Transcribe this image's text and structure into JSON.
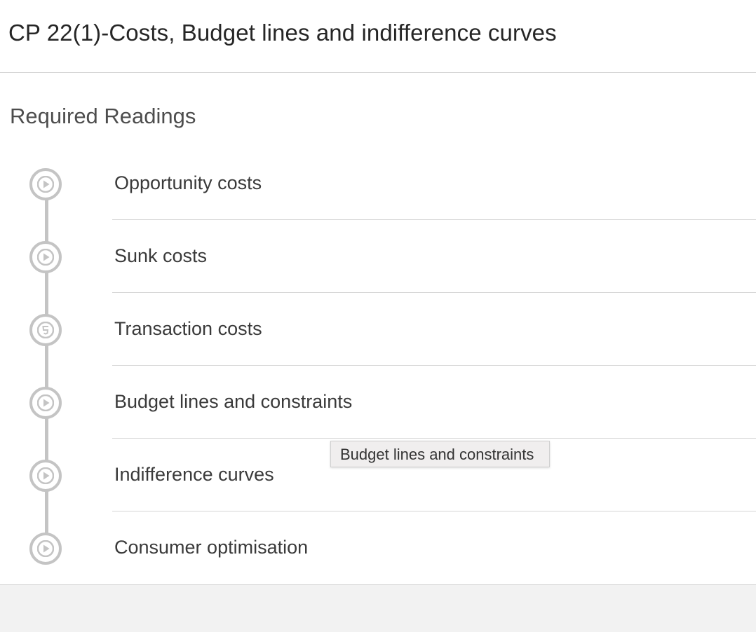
{
  "header": {
    "title": "CP 22(1)-Costs, Budget lines and indifference curves"
  },
  "section": {
    "heading": "Required Readings"
  },
  "readings": [
    {
      "label": "Opportunity costs",
      "icon": "play-icon"
    },
    {
      "label": "Sunk costs",
      "icon": "play-icon"
    },
    {
      "label": "Transaction costs",
      "icon": "html5-icon"
    },
    {
      "label": "Budget lines and constraints",
      "icon": "play-icon"
    },
    {
      "label": "Indifference curves",
      "icon": "play-icon"
    },
    {
      "label": "Consumer optimisation",
      "icon": "play-icon"
    }
  ],
  "tooltip": {
    "text": "Budget lines and constraints"
  },
  "colors": {
    "icon_gray": "#c4c4c4",
    "divider": "#d6d6d6",
    "footer_bg": "#f2f2f2"
  }
}
